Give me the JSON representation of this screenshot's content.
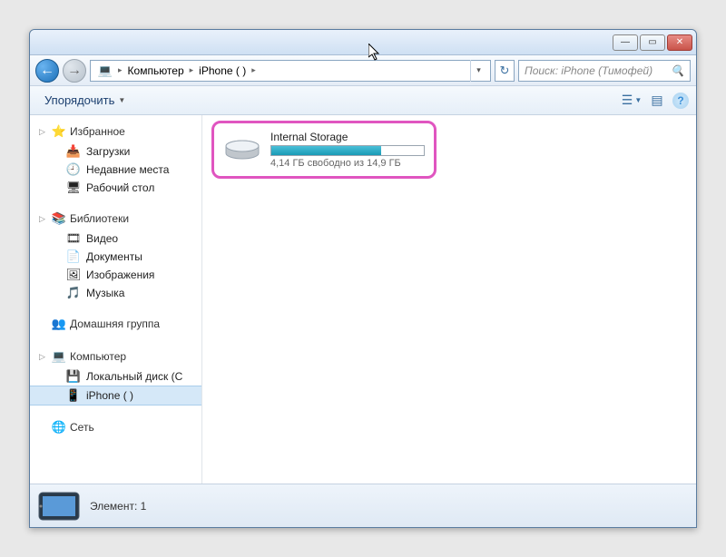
{
  "window": {
    "min": "—",
    "max": "▭",
    "close": "✕"
  },
  "nav": {
    "back": "←",
    "fwd": "→"
  },
  "breadcrumb": {
    "root_icon": "💻",
    "seg1": "Компьютер",
    "seg2": "iPhone (            )",
    "sep": "▸",
    "dropdown": "▾"
  },
  "refresh_icon": "↻",
  "search": {
    "placeholder": "Поиск: iPhone (Тимофей)",
    "icon": "🔍"
  },
  "toolbar": {
    "organize": "Упорядочить",
    "arrow": "▼",
    "view_icon": "☰",
    "preview_icon": "▤",
    "help_icon": "?"
  },
  "sidebar": {
    "favorites": {
      "label": "Избранное",
      "icon": "⭐",
      "items": [
        {
          "icon": "📥",
          "label": "Загрузки"
        },
        {
          "icon": "🕘",
          "label": "Недавние места"
        },
        {
          "icon": "🖥",
          "label": "Рабочий стол"
        }
      ]
    },
    "libraries": {
      "label": "Библиотеки",
      "icon": "📚",
      "items": [
        {
          "icon": "🎞",
          "label": "Видео"
        },
        {
          "icon": "📄",
          "label": "Документы"
        },
        {
          "icon": "🖼",
          "label": "Изображения"
        },
        {
          "icon": "🎵",
          "label": "Музыка"
        }
      ]
    },
    "homegroup": {
      "label": "Домашняя группа",
      "icon": "👥"
    },
    "computer": {
      "label": "Компьютер",
      "icon": "💻",
      "items": [
        {
          "icon": "💾",
          "label": "Локальный диск (C"
        },
        {
          "icon": "📱",
          "label": "iPhone (            )",
          "selected": true
        }
      ]
    },
    "network": {
      "label": "Сеть",
      "icon": "🌐"
    }
  },
  "content": {
    "item": {
      "name": "Internal Storage",
      "free_text": "4,14 ГБ свободно из 14,9 ГБ",
      "used_percent": 72
    }
  },
  "status": {
    "label": "Элемент: 1"
  }
}
